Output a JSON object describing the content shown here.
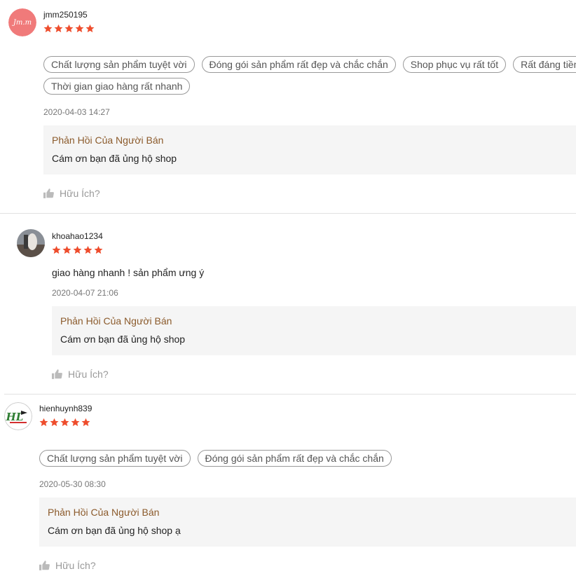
{
  "reviews": [
    {
      "username": "jmm250195",
      "rating": 5,
      "avatar_text": "Jm.m",
      "tags": [
        "Chất lượng sản phẩm tuyệt vời",
        "Đóng gói sản phẩm rất đẹp và chắc chắn",
        "Shop phục vụ rất tốt",
        "Rất đáng tiền",
        "Thời gian giao hàng rất nhanh"
      ],
      "comment": "",
      "timestamp": "2020-04-03 14:27",
      "reply_title": "Phản Hồi Của Người Bán",
      "reply_text": "Cám ơn bạn đã ủng hộ shop",
      "helpful_label": "Hữu Ích?"
    },
    {
      "username": "khoahao1234",
      "rating": 5,
      "tags": [],
      "comment": "giao hàng nhanh ! sản phẩm ưng ý",
      "timestamp": "2020-04-07 21:06",
      "reply_title": "Phản Hồi Của Người Bán",
      "reply_text": "Cám ơn bạn đã ủng hộ shop",
      "helpful_label": "Hữu Ích?"
    },
    {
      "username": "hienhuynh839",
      "rating": 5,
      "avatar_text": "HL",
      "tags": [
        "Chất lượng sản phẩm tuyệt vời",
        "Đóng gói sản phẩm rất đẹp và chắc chắn"
      ],
      "comment": "",
      "timestamp": "2020-05-30 08:30",
      "reply_title": "Phản Hồi Của Người Bán",
      "reply_text": "Cám ơn bạn đã ủng hộ shop ạ",
      "helpful_label": "Hữu Ích?"
    }
  ],
  "colors": {
    "star": "#ee4d2d",
    "reply_title": "#8b5a2b",
    "avatar1_bg": "#f07a7a"
  },
  "icons": {
    "star": "star-icon",
    "helpful": "thumbs-up-icon"
  }
}
